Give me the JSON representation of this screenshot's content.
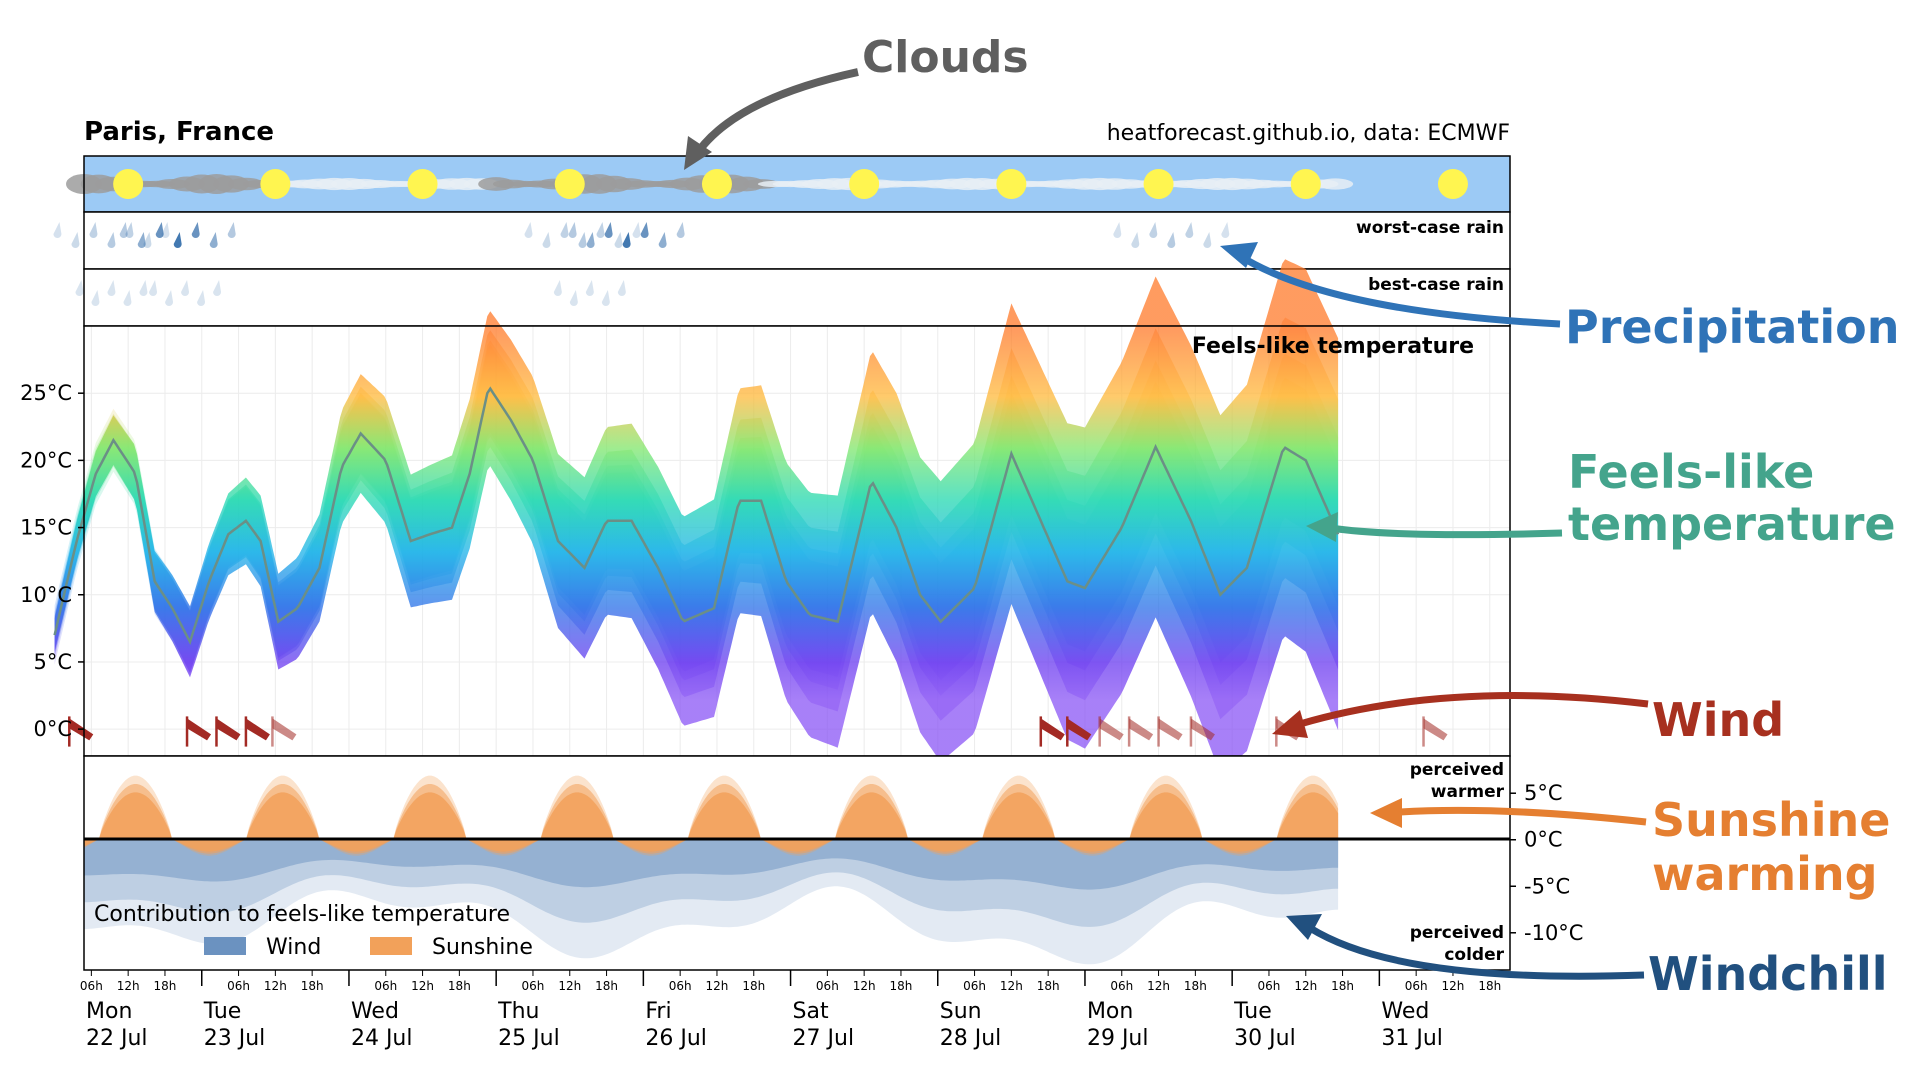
{
  "header": {
    "location": "Paris, France",
    "credit": "heatforecast.github.io, data: ECMWF"
  },
  "panels": {
    "worst_rain_label": "worst-case rain",
    "best_rain_label": "best-case rain",
    "feels_title": "Feels-like temperature",
    "contrib_warmer": [
      "perceived",
      "warmer"
    ],
    "contrib_colder": [
      "perceived",
      "colder"
    ]
  },
  "callouts": {
    "clouds": "Clouds",
    "precip": "Precipitation",
    "feels": [
      "Feels-like",
      "temperature"
    ],
    "wind": "Wind",
    "sunshine": [
      "Sunshine",
      "warming"
    ],
    "windchill": "Windchill"
  },
  "legend": {
    "title": "Contribution to feels-like temperature",
    "items": [
      "Wind",
      "Sunshine"
    ]
  },
  "colors": {
    "sky": "#9ccaf5",
    "sun": "#fff550",
    "cloud": "#a8a8a8",
    "rain": "#2f6aa8",
    "wind_flag": "#a32a24",
    "sunshine": "#f2a15a",
    "windchill": "#6b92c0",
    "callout_clouds": "#5f5f5f",
    "callout_precip": "#2f73b7",
    "callout_feels": "#44a48c",
    "callout_wind": "#a7301f",
    "callout_sunshine": "#e57f31",
    "callout_windchill": "#21507f"
  },
  "chart_data": {
    "type": "area",
    "title": "Feels-like temperature",
    "y_ticks": [
      "25°C",
      "20°C",
      "15°C",
      "10°C",
      "5°C",
      "0°C"
    ],
    "y_tick_values": [
      25,
      20,
      15,
      10,
      5,
      0
    ],
    "ylim": [
      -2,
      30
    ],
    "contrib_ticks": [
      "5°C",
      "0°C",
      "-5°C",
      "-10°C"
    ],
    "contrib_tick_values": [
      5,
      0,
      -5,
      -10
    ],
    "contrib_ylim": [
      -14,
      9
    ],
    "hour_ticks": [
      "06h",
      "12h",
      "18h"
    ],
    "days": [
      {
        "dow": "Mon",
        "date": "22 Jul"
      },
      {
        "dow": "Tue",
        "date": "23 Jul"
      },
      {
        "dow": "Wed",
        "date": "24 Jul"
      },
      {
        "dow": "Thu",
        "date": "25 Jul"
      },
      {
        "dow": "Fri",
        "date": "26 Jul"
      },
      {
        "dow": "Sat",
        "date": "27 Jul"
      },
      {
        "dow": "Sun",
        "date": "28 Jul"
      },
      {
        "dow": "Mon",
        "date": "29 Jul"
      },
      {
        "dow": "Tue",
        "date": "30 Jul"
      },
      {
        "dow": "Wed",
        "date": "31 Jul"
      }
    ],
    "series": [
      {
        "name": "Feels-like temperature",
        "points": [
          [
            0.0,
            7
          ],
          [
            0.15,
            14
          ],
          [
            0.28,
            19
          ],
          [
            0.4,
            21.5
          ],
          [
            0.55,
            19
          ],
          [
            0.68,
            11
          ],
          [
            0.8,
            9
          ],
          [
            0.92,
            6.5
          ],
          [
            1.05,
            11
          ],
          [
            1.18,
            14.5
          ],
          [
            1.3,
            15.5
          ],
          [
            1.4,
            14
          ],
          [
            1.52,
            8
          ],
          [
            1.65,
            9
          ],
          [
            1.8,
            12
          ],
          [
            1.95,
            19.5
          ],
          [
            2.08,
            22
          ],
          [
            2.25,
            20
          ],
          [
            2.42,
            14
          ],
          [
            2.55,
            14.5
          ],
          [
            2.7,
            15
          ],
          [
            2.82,
            19
          ],
          [
            2.95,
            25.5
          ],
          [
            3.1,
            23
          ],
          [
            3.25,
            20
          ],
          [
            3.42,
            14
          ],
          [
            3.6,
            12
          ],
          [
            3.75,
            15.5
          ],
          [
            3.92,
            15.5
          ],
          [
            4.1,
            12
          ],
          [
            4.27,
            8
          ],
          [
            4.48,
            9
          ],
          [
            4.65,
            17
          ],
          [
            4.8,
            17
          ],
          [
            4.97,
            11
          ],
          [
            5.13,
            8.5
          ],
          [
            5.32,
            8
          ],
          [
            5.55,
            18.5
          ],
          [
            5.72,
            15
          ],
          [
            5.88,
            10
          ],
          [
            6.02,
            8
          ],
          [
            6.25,
            10.5
          ],
          [
            6.5,
            20.5
          ],
          [
            6.72,
            15
          ],
          [
            6.88,
            11
          ],
          [
            7.0,
            10.5
          ],
          [
            7.25,
            15
          ],
          [
            7.48,
            21
          ],
          [
            7.72,
            15.5
          ],
          [
            7.92,
            10
          ],
          [
            8.1,
            12
          ],
          [
            8.35,
            21
          ],
          [
            8.5,
            20
          ],
          [
            8.72,
            14.5
          ]
        ]
      }
    ],
    "worst_case_rain_days": [
      0.4,
      0.85,
      3.6,
      3.9,
      7.6
    ],
    "best_case_rain_days": [
      0.4,
      0.9,
      3.65
    ],
    "wind_flag_days": [
      0.1,
      0.9,
      1.1,
      1.3,
      1.48,
      6.7,
      6.88,
      7.1,
      7.3,
      7.5,
      7.72,
      8.3,
      9.3
    ],
    "legend": [
      "Wind",
      "Sunshine"
    ],
    "grid": true
  }
}
